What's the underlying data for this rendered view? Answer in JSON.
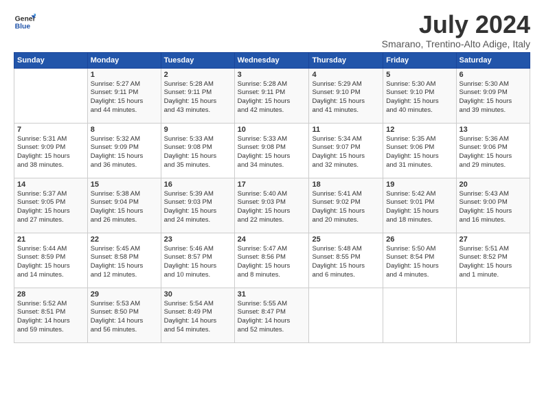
{
  "logo": {
    "line1": "General",
    "line2": "Blue"
  },
  "title": "July 2024",
  "subtitle": "Smarano, Trentino-Alto Adige, Italy",
  "days_header": [
    "Sunday",
    "Monday",
    "Tuesday",
    "Wednesday",
    "Thursday",
    "Friday",
    "Saturday"
  ],
  "weeks": [
    [
      {
        "day": "",
        "info": ""
      },
      {
        "day": "1",
        "info": "Sunrise: 5:27 AM\nSunset: 9:11 PM\nDaylight: 15 hours\nand 44 minutes."
      },
      {
        "day": "2",
        "info": "Sunrise: 5:28 AM\nSunset: 9:11 PM\nDaylight: 15 hours\nand 43 minutes."
      },
      {
        "day": "3",
        "info": "Sunrise: 5:28 AM\nSunset: 9:11 PM\nDaylight: 15 hours\nand 42 minutes."
      },
      {
        "day": "4",
        "info": "Sunrise: 5:29 AM\nSunset: 9:10 PM\nDaylight: 15 hours\nand 41 minutes."
      },
      {
        "day": "5",
        "info": "Sunrise: 5:30 AM\nSunset: 9:10 PM\nDaylight: 15 hours\nand 40 minutes."
      },
      {
        "day": "6",
        "info": "Sunrise: 5:30 AM\nSunset: 9:09 PM\nDaylight: 15 hours\nand 39 minutes."
      }
    ],
    [
      {
        "day": "7",
        "info": "Sunrise: 5:31 AM\nSunset: 9:09 PM\nDaylight: 15 hours\nand 38 minutes."
      },
      {
        "day": "8",
        "info": "Sunrise: 5:32 AM\nSunset: 9:09 PM\nDaylight: 15 hours\nand 36 minutes."
      },
      {
        "day": "9",
        "info": "Sunrise: 5:33 AM\nSunset: 9:08 PM\nDaylight: 15 hours\nand 35 minutes."
      },
      {
        "day": "10",
        "info": "Sunrise: 5:33 AM\nSunset: 9:08 PM\nDaylight: 15 hours\nand 34 minutes."
      },
      {
        "day": "11",
        "info": "Sunrise: 5:34 AM\nSunset: 9:07 PM\nDaylight: 15 hours\nand 32 minutes."
      },
      {
        "day": "12",
        "info": "Sunrise: 5:35 AM\nSunset: 9:06 PM\nDaylight: 15 hours\nand 31 minutes."
      },
      {
        "day": "13",
        "info": "Sunrise: 5:36 AM\nSunset: 9:06 PM\nDaylight: 15 hours\nand 29 minutes."
      }
    ],
    [
      {
        "day": "14",
        "info": "Sunrise: 5:37 AM\nSunset: 9:05 PM\nDaylight: 15 hours\nand 27 minutes."
      },
      {
        "day": "15",
        "info": "Sunrise: 5:38 AM\nSunset: 9:04 PM\nDaylight: 15 hours\nand 26 minutes."
      },
      {
        "day": "16",
        "info": "Sunrise: 5:39 AM\nSunset: 9:03 PM\nDaylight: 15 hours\nand 24 minutes."
      },
      {
        "day": "17",
        "info": "Sunrise: 5:40 AM\nSunset: 9:03 PM\nDaylight: 15 hours\nand 22 minutes."
      },
      {
        "day": "18",
        "info": "Sunrise: 5:41 AM\nSunset: 9:02 PM\nDaylight: 15 hours\nand 20 minutes."
      },
      {
        "day": "19",
        "info": "Sunrise: 5:42 AM\nSunset: 9:01 PM\nDaylight: 15 hours\nand 18 minutes."
      },
      {
        "day": "20",
        "info": "Sunrise: 5:43 AM\nSunset: 9:00 PM\nDaylight: 15 hours\nand 16 minutes."
      }
    ],
    [
      {
        "day": "21",
        "info": "Sunrise: 5:44 AM\nSunset: 8:59 PM\nDaylight: 15 hours\nand 14 minutes."
      },
      {
        "day": "22",
        "info": "Sunrise: 5:45 AM\nSunset: 8:58 PM\nDaylight: 15 hours\nand 12 minutes."
      },
      {
        "day": "23",
        "info": "Sunrise: 5:46 AM\nSunset: 8:57 PM\nDaylight: 15 hours\nand 10 minutes."
      },
      {
        "day": "24",
        "info": "Sunrise: 5:47 AM\nSunset: 8:56 PM\nDaylight: 15 hours\nand 8 minutes."
      },
      {
        "day": "25",
        "info": "Sunrise: 5:48 AM\nSunset: 8:55 PM\nDaylight: 15 hours\nand 6 minutes."
      },
      {
        "day": "26",
        "info": "Sunrise: 5:50 AM\nSunset: 8:54 PM\nDaylight: 15 hours\nand 4 minutes."
      },
      {
        "day": "27",
        "info": "Sunrise: 5:51 AM\nSunset: 8:52 PM\nDaylight: 15 hours\nand 1 minute."
      }
    ],
    [
      {
        "day": "28",
        "info": "Sunrise: 5:52 AM\nSunset: 8:51 PM\nDaylight: 14 hours\nand 59 minutes."
      },
      {
        "day": "29",
        "info": "Sunrise: 5:53 AM\nSunset: 8:50 PM\nDaylight: 14 hours\nand 56 minutes."
      },
      {
        "day": "30",
        "info": "Sunrise: 5:54 AM\nSunset: 8:49 PM\nDaylight: 14 hours\nand 54 minutes."
      },
      {
        "day": "31",
        "info": "Sunrise: 5:55 AM\nSunset: 8:47 PM\nDaylight: 14 hours\nand 52 minutes."
      },
      {
        "day": "",
        "info": ""
      },
      {
        "day": "",
        "info": ""
      },
      {
        "day": "",
        "info": ""
      }
    ]
  ]
}
